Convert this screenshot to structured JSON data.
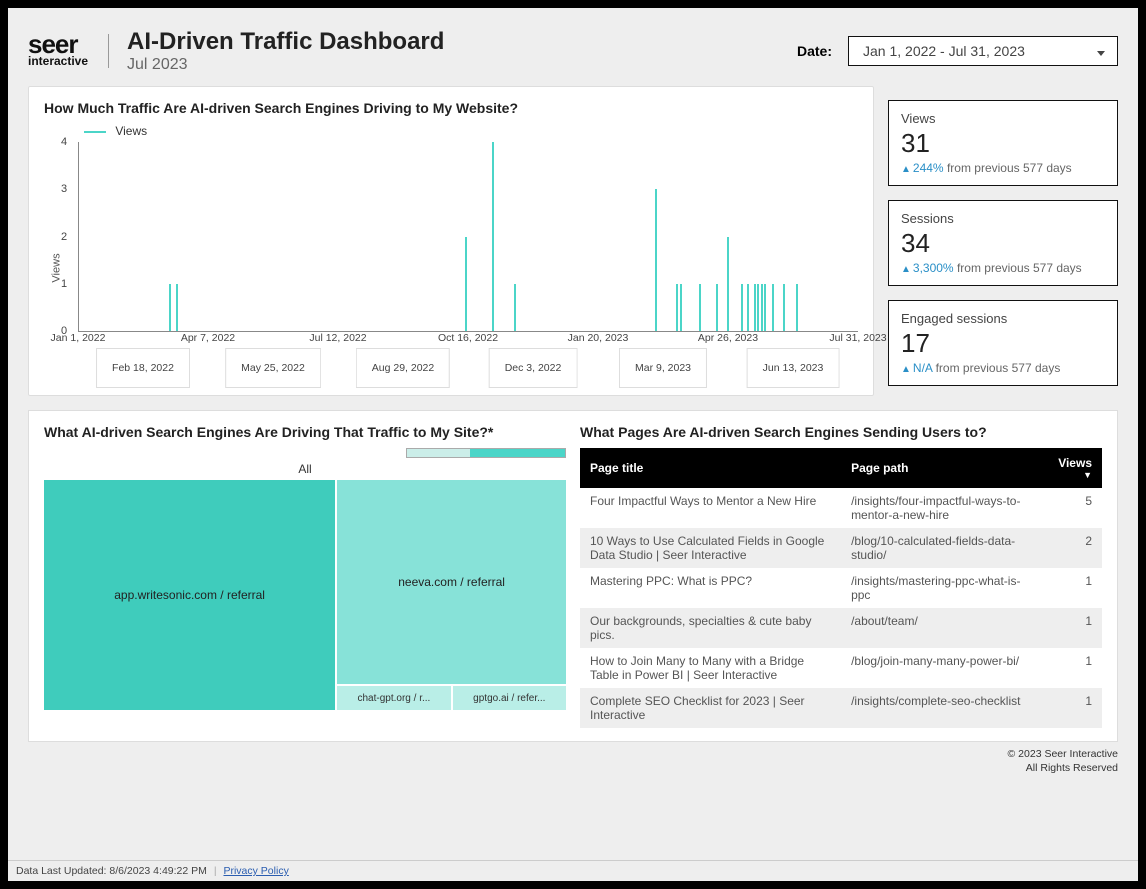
{
  "header": {
    "logo_brand": "seer",
    "logo_sub": "interactive",
    "title": "AI-Driven Traffic Dashboard",
    "subtitle": "Jul 2023",
    "date_label": "Date:",
    "date_value": "Jan 1, 2022 - Jul 31, 2023"
  },
  "chart": {
    "title": "How Much Traffic Are AI-driven Search Engines Driving to My Website?",
    "legend_label": "Views",
    "y_axis_label": "Views",
    "y_ticks": [
      "0",
      "1",
      "2",
      "3",
      "4"
    ],
    "x_ticks_row1": [
      "Jan 1, 2022",
      "Apr 7, 2022",
      "Jul 12, 2022",
      "Oct 16, 2022",
      "Jan 20, 2023",
      "Apr 26, 2023",
      "Jul 31, 2023"
    ],
    "x_ticks_row2": [
      "Feb 18, 2022",
      "May 25, 2022",
      "Aug 29, 2022",
      "Dec 3, 2022",
      "Mar 9, 2023",
      "Jun 13, 2023"
    ]
  },
  "chart_data": {
    "type": "bar",
    "series_name": "Views",
    "ylabel": "Views",
    "ylim": [
      0,
      4
    ],
    "points": [
      {
        "x": 0.115,
        "y": 1
      },
      {
        "x": 0.124,
        "y": 1
      },
      {
        "x": 0.495,
        "y": 2
      },
      {
        "x": 0.53,
        "y": 4
      },
      {
        "x": 0.558,
        "y": 1
      },
      {
        "x": 0.74,
        "y": 3
      },
      {
        "x": 0.766,
        "y": 1
      },
      {
        "x": 0.772,
        "y": 1
      },
      {
        "x": 0.796,
        "y": 1
      },
      {
        "x": 0.818,
        "y": 1
      },
      {
        "x": 0.832,
        "y": 2
      },
      {
        "x": 0.85,
        "y": 1
      },
      {
        "x": 0.858,
        "y": 1
      },
      {
        "x": 0.866,
        "y": 1
      },
      {
        "x": 0.87,
        "y": 1
      },
      {
        "x": 0.875,
        "y": 1
      },
      {
        "x": 0.879,
        "y": 1
      },
      {
        "x": 0.89,
        "y": 1
      },
      {
        "x": 0.904,
        "y": 1
      },
      {
        "x": 0.92,
        "y": 1
      }
    ]
  },
  "stats": [
    {
      "label": "Views",
      "value": "31",
      "pct": "244%",
      "suffix": " from previous 577 days"
    },
    {
      "label": "Sessions",
      "value": "34",
      "pct": "3,300%",
      "suffix": " from previous 577 days"
    },
    {
      "label": "Engaged sessions",
      "value": "17",
      "pct": "N/A",
      "suffix": " from previous 577 days"
    }
  ],
  "treemap": {
    "title": "What AI-driven Search Engines Are Driving That Traffic to My Site?*",
    "breadcrumb": "All",
    "cells": {
      "large": "app.writesonic.com / referral",
      "medium": "neeva.com / referral",
      "small1": "chat-gpt.org / r...",
      "small2": "gptgo.ai / refer..."
    }
  },
  "table": {
    "title": "What Pages Are AI-driven Search Engines Sending Users to?",
    "headers": [
      "Page title",
      "Page path",
      "Views"
    ],
    "rows": [
      {
        "title": "Four Impactful Ways to Mentor a New Hire",
        "path": "/insights/four-impactful-ways-to-mentor-a-new-hire",
        "views": "5"
      },
      {
        "title": "10 Ways to Use Calculated Fields in Google Data Studio | Seer Interactive",
        "path": "/blog/10-calculated-fields-data-studio/",
        "views": "2"
      },
      {
        "title": "Mastering PPC: What is PPC?",
        "path": "/insights/mastering-ppc-what-is-ppc",
        "views": "1"
      },
      {
        "title": "Our backgrounds, specialties & cute baby pics.",
        "path": "/about/team/",
        "views": "1"
      },
      {
        "title": "How to Join Many to Many with a Bridge Table in Power BI | Seer Interactive",
        "path": "/blog/join-many-many-power-bi/",
        "views": "1"
      },
      {
        "title": "Complete SEO Checklist for 2023 | Seer Interactive",
        "path": "/insights/complete-seo-checklist",
        "views": "1"
      }
    ]
  },
  "copyright": {
    "line1": "© 2023 Seer Interactive",
    "line2": "All Rights Reserved"
  },
  "footer": {
    "last_updated": "Data Last Updated: 8/6/2023 4:49:22 PM",
    "privacy": "Privacy Policy"
  }
}
